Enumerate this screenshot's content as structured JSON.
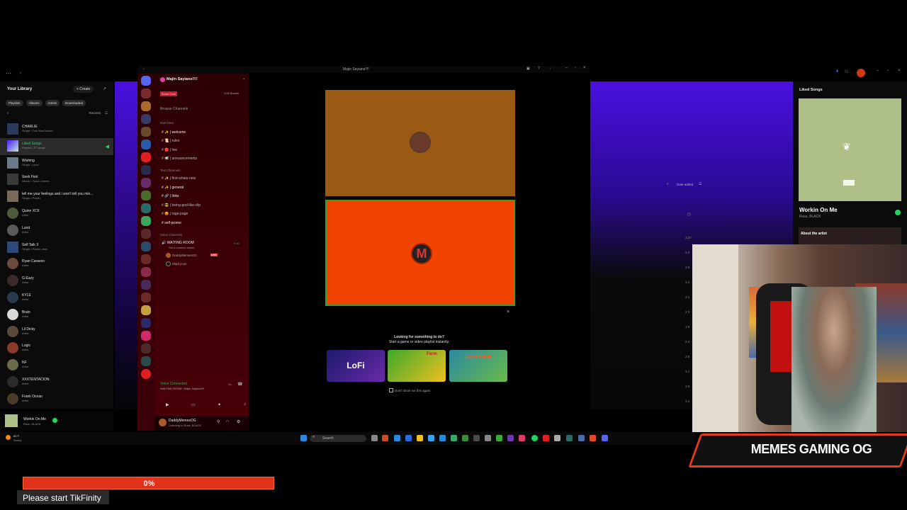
{
  "spotify": {
    "library_title": "Your Library",
    "create_label": "+ Create",
    "filters": [
      "Playlists",
      "Albums",
      "Artists",
      "Downloaded"
    ],
    "recents_label": "Recents",
    "items": [
      {
        "title": "CHARLIE",
        "sub": "Single • Tom MacDonald"
      },
      {
        "title": "Liked Songs",
        "sub": "Playlist • 37 songs"
      },
      {
        "title": "Wishing",
        "sub": "Single • Lund"
      },
      {
        "title": "Seek First",
        "sub": "Album • Tyson James"
      },
      {
        "title": "tell me your feelings and i won't tell you min...",
        "sub": "Single • Powfu"
      },
      {
        "title": "Quinn XCII",
        "sub": "Artist"
      },
      {
        "title": "Lund",
        "sub": "Artist"
      },
      {
        "title": "Self Talk 3",
        "sub": "Single • Parker Jack"
      },
      {
        "title": "Ryan Caraveo",
        "sub": "Artist"
      },
      {
        "title": "G-Eazy",
        "sub": "Artist"
      },
      {
        "title": "KYLE",
        "sub": "Artist"
      },
      {
        "title": "Brain",
        "sub": "Artist"
      },
      {
        "title": "Lil Dicky",
        "sub": "Artist"
      },
      {
        "title": "Logic",
        "sub": "Artist"
      },
      {
        "title": "NF",
        "sub": "Artist"
      },
      {
        "title": "XXXTENTACION",
        "sub": "Artist"
      },
      {
        "title": "Frank Ocean",
        "sub": "Artist"
      }
    ],
    "now_playing_title": "Workin On Me",
    "now_playing_artist": "Russ, BLACK",
    "liked_songs_header": "Liked Songs",
    "date_added_label": "Date added",
    "about_artist_label": "About the artist",
    "track_times": [
      "3:37",
      "2:2",
      "3:0",
      "3:1",
      "3:1",
      "2:3",
      "1:5",
      "2:2",
      "2:5",
      "3:1",
      "3:0",
      "3:1"
    ]
  },
  "discord": {
    "window_title": "Majin Sayians!!!!",
    "server_name": "Majin Sayians!!!!",
    "boost_label": "Boost Goal",
    "boost_count": "2/28 Boosts",
    "browse_channels": "Browse Channels",
    "categories": {
      "start": "start here",
      "text": "Text Channels",
      "voice": "Voice Channels"
    },
    "start_channels": [
      "welcome",
      "rules",
      "live",
      "announcements"
    ],
    "text_channels": [
      "find-whats-new",
      "general",
      "links",
      "being-god-like-clip",
      "rage-page",
      "self-promo"
    ],
    "voice_channel": "WAITING ROOM",
    "voice_timer": "0:00",
    "voice_status": "Set a channel status",
    "voice_users": [
      "DaddyMemesOG",
      "Madi.ycas"
    ],
    "live_badge": "LIVE",
    "voice_connected": "Voice Connected",
    "voice_connected_sub": "WAITING ROOM / Majin Sayians!!!",
    "user_name": "DaddyMemesOG",
    "user_status": "Listening to Russ, BLACK",
    "activity_heading": "Looking for something to do?",
    "activity_sub": "Start a game or video playlist instantly.",
    "activities": [
      "LoFi",
      "Farm",
      "BATTLESHIP"
    ],
    "dont_show": "Don't show me this again.",
    "close_glyph": "×"
  },
  "taskbar": {
    "search_label": "Search",
    "weather_temp": "86°F",
    "weather_desc": "Sunny"
  },
  "overlay": {
    "banner_text": "MEMES GAMING OG",
    "tik_progress_pct": 0,
    "tik_progress_label": "0%",
    "tik_message": "Please start TikFinity"
  },
  "colors": {
    "spotify_green": "#1ed760",
    "discord_red": "#4a0008",
    "tile_orange": "#f04400",
    "tik_red": "#e1321c"
  }
}
